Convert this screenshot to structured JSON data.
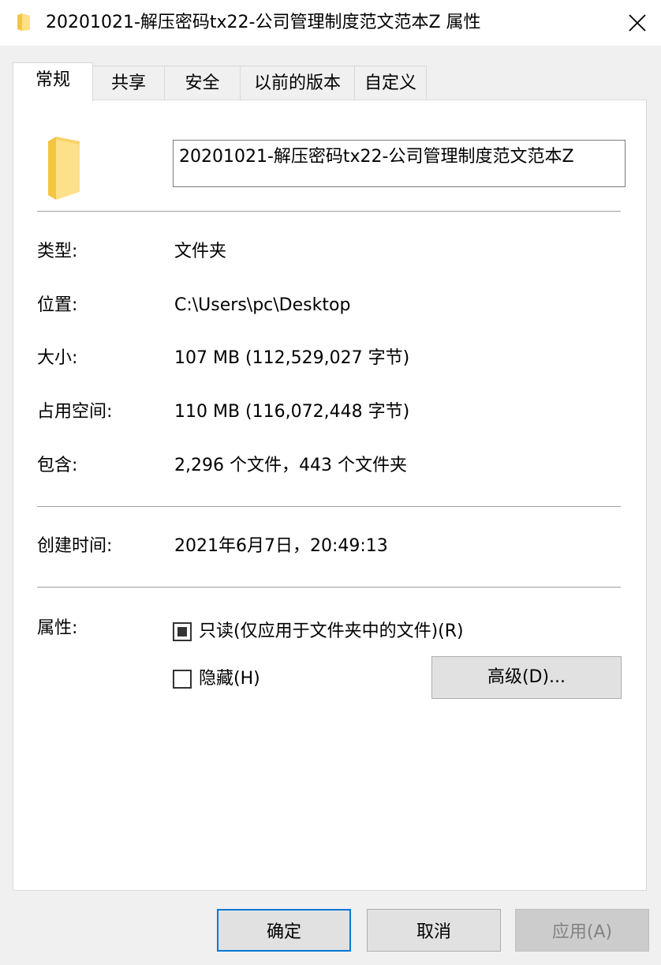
{
  "window": {
    "title": "20201021-解压密码tx22-公司管理制度范文范本Z 属性",
    "close_icon": "close-icon"
  },
  "tabs": [
    {
      "label": "常规",
      "active": true
    },
    {
      "label": "共享",
      "active": false
    },
    {
      "label": "安全",
      "active": false
    },
    {
      "label": "以前的版本",
      "active": false
    },
    {
      "label": "自定义",
      "active": false
    }
  ],
  "general": {
    "folder_icon": "folder-icon",
    "name_value": "20201021-解压密码tx22-公司管理制度范文范本Z",
    "type_label": "类型:",
    "type_value": "文件夹",
    "location_label": "位置:",
    "location_value": "C:\\Users\\pc\\Desktop",
    "size_label": "大小:",
    "size_value": "107 MB (112,529,027 字节)",
    "size_on_disk_label": "占用空间:",
    "size_on_disk_value": "110 MB (116,072,448 字节)",
    "contains_label": "包含:",
    "contains_value": "2,296 个文件，443 个文件夹",
    "created_label": "创建时间:",
    "created_value": "2021年6月7日，20:49:13",
    "attributes_label": "属性:",
    "readonly_label": "只读(仅应用于文件夹中的文件)(R)",
    "readonly_state": "indeterminate",
    "hidden_label": "隐藏(H)",
    "hidden_checked": false,
    "advanced_button": "高级(D)..."
  },
  "buttons": {
    "ok": "确定",
    "cancel": "取消",
    "apply": "应用(A)"
  },
  "colors": {
    "accent": "#0078d7",
    "folder_light": "#ffe08a",
    "folder_dark": "#f4c542"
  }
}
